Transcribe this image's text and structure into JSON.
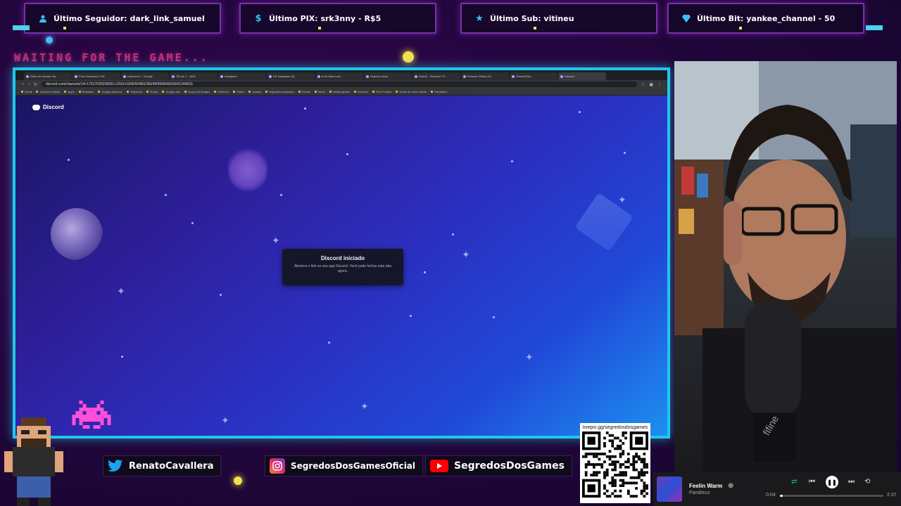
{
  "alerts": [
    {
      "text": "Último Seguidor: dark_link_samuel",
      "icon": "user-icon"
    },
    {
      "text": "Último PIX: srk3nny - R$5",
      "icon": "dollar-icon"
    },
    {
      "text": "Último Sub: vitineu",
      "icon": "star-icon"
    },
    {
      "text": "Último Bit: yankee_channel - 50",
      "icon": "diamond-icon"
    }
  ],
  "waiting_text": "WAITING FOR THE GAME...",
  "browser": {
    "tabs": [
      "Gabe de wendon Sa",
      "Form Diamond 1.2M",
      "Diamond 2 - Google",
      "Tik-tok 7 - 160K",
      "Instagram",
      "DS Instagram (9)",
      "Irmã Nabi local",
      "Usando Guias",
      "DeadX - StreamX Tit",
      "Release Github 6.0",
      "ShortsGSky",
      "Discord"
    ],
    "url": "discord.com/channels/14+17017035228001+2333+0306/5048/1050/4505606405160/1240633",
    "bookmarks": [
      "Gmail",
      "Youtube Estudio",
      "Apps",
      "Enfeitado",
      "Google Adsense",
      "Yokkie/ok",
      "Shoop",
      "Google Ads",
      "los jus de imagen",
      "Pinterest",
      "Twitch",
      "Jeanas",
      "Segredos cachoeira",
      "Fontes",
      "Menu",
      "Ideias games",
      "Liveload",
      "Pixel Guides",
      "Guias de novo vídeos",
      "Handsfree"
    ]
  },
  "discord": {
    "brand": "Discord",
    "toast_title": "Discord iniciado",
    "toast_body": "Abrimos o link no seu app Discord. Você pode fechar esta aba agora."
  },
  "socials": [
    {
      "text": "RenatoCavallera",
      "icon": "twitter-icon",
      "color": "#1da1f2"
    },
    {
      "text": "SegredosDosGamesOficial",
      "icon": "instagram-icon",
      "color": "#d62976"
    },
    {
      "text": "SegredosDosGames",
      "icon": "youtube-icon",
      "color": "#ff0000"
    }
  ],
  "qr_label": "livepix.gg/segredosdosgames",
  "player": {
    "title": "Feelin Warm",
    "artist": "Pandrezz",
    "time_current": "0:04",
    "time_total": "2:37",
    "progress": 0.03
  },
  "colors": {
    "frame": "#1fc7ea",
    "waiting": "#c2327a",
    "accent": "#7a2fb0"
  }
}
